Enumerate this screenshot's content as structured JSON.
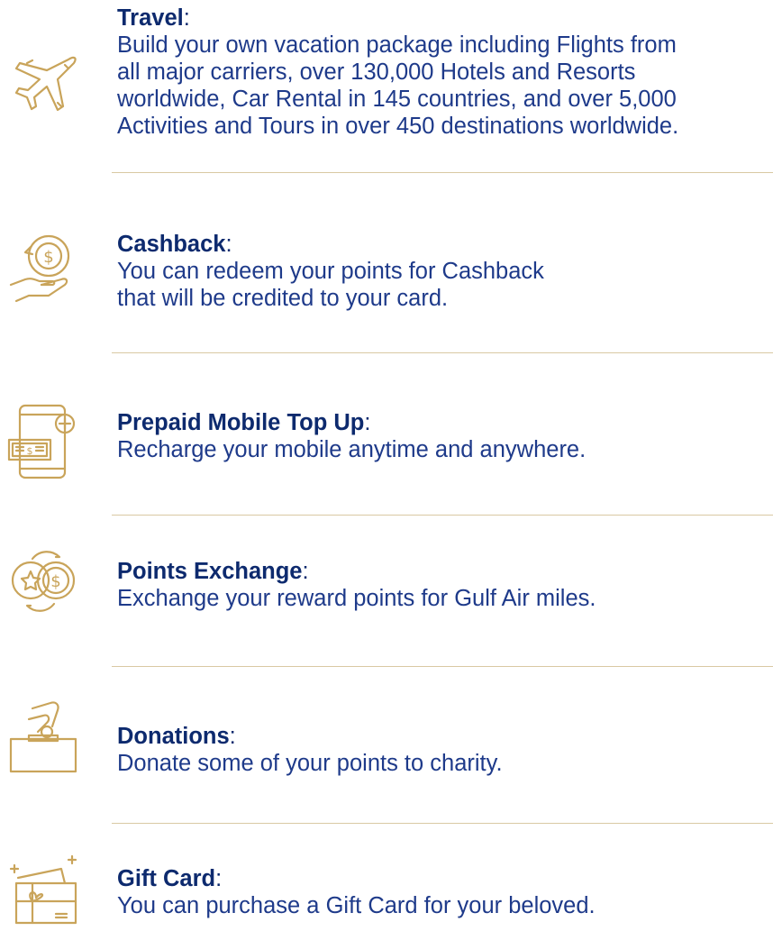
{
  "colors": {
    "gold": "#c9a45a",
    "navy": "#0d2a6e",
    "divider": "#d9c9a3"
  },
  "items": [
    {
      "title": "Travel",
      "colon": ":",
      "lines": [
        "Build your own vacation package including Flights from",
        "all major carriers, over 130,000 Hotels and Resorts",
        "worldwide, Car Rental in 145 countries, and over 5,000",
        "Activities and Tours in over 450 destinations worldwide."
      ],
      "icon": "airplane-icon"
    },
    {
      "title": "Cashback",
      "colon": ":",
      "lines": [
        "You can redeem your points for Cashback",
        "that will be credited to your card."
      ],
      "icon": "cashback-hand-icon"
    },
    {
      "title": "Prepaid Mobile Top Up",
      "colon": ":",
      "lines": [
        "Recharge your mobile anytime and anywhere."
      ],
      "icon": "mobile-topup-icon"
    },
    {
      "title": "Points Exchange",
      "colon": ":",
      "lines": [
        "Exchange your reward points for Gulf Air miles."
      ],
      "icon": "points-exchange-icon"
    },
    {
      "title": "Donations",
      "colon": ":",
      "lines": [
        "Donate some of your points to charity."
      ],
      "icon": "donation-box-icon"
    },
    {
      "title": "Gift Card",
      "colon": ":",
      "lines": [
        "You can purchase a Gift Card for your beloved."
      ],
      "icon": "gift-card-icon"
    }
  ]
}
